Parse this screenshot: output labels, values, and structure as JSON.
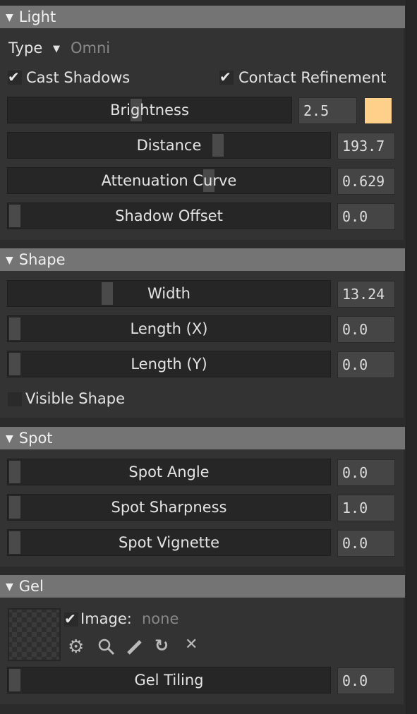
{
  "light": {
    "title": "Light",
    "type_label": "Type",
    "type_value": "Omni",
    "cast_shadows": {
      "label": "Cast Shadows",
      "checked": true
    },
    "contact_refinement": {
      "label": "Contact Refinement",
      "checked": true
    },
    "brightness": {
      "label": "Brightness",
      "value": "2.5",
      "level": 0.45
    },
    "color": "#ffd08a",
    "distance": {
      "label": "Distance",
      "value": "193.7",
      "level": 0.66
    },
    "attenuation": {
      "label": "Attenuation Curve",
      "value": "0.629",
      "level": 0.63
    },
    "shadow_offset": {
      "label": "Shadow Offset",
      "value": "0.0",
      "level": 0
    }
  },
  "shape": {
    "title": "Shape",
    "width": {
      "label": "Width",
      "value": "13.24",
      "level": 0.3
    },
    "length_x": {
      "label": "Length (X)",
      "value": "0.0",
      "level": 0
    },
    "length_y": {
      "label": "Length (Y)",
      "value": "0.0",
      "level": 0
    },
    "visible_shape": {
      "label": "Visible Shape",
      "checked": false
    }
  },
  "spot": {
    "title": "Spot",
    "angle": {
      "label": "Spot Angle",
      "value": "0.0",
      "level": 0
    },
    "sharpness": {
      "label": "Spot Sharpness",
      "value": "1.0",
      "level": 0
    },
    "vignette": {
      "label": "Spot Vignette",
      "value": "0.0",
      "level": 0
    }
  },
  "gel": {
    "title": "Gel",
    "image_label": "Image:",
    "image_value": "none",
    "image_checked": true,
    "icons": [
      "gear-icon",
      "search-icon",
      "pencil-icon",
      "refresh-icon",
      "close-icon"
    ],
    "tiling": {
      "label": "Gel Tiling",
      "value": "0.0",
      "level": 0
    }
  }
}
